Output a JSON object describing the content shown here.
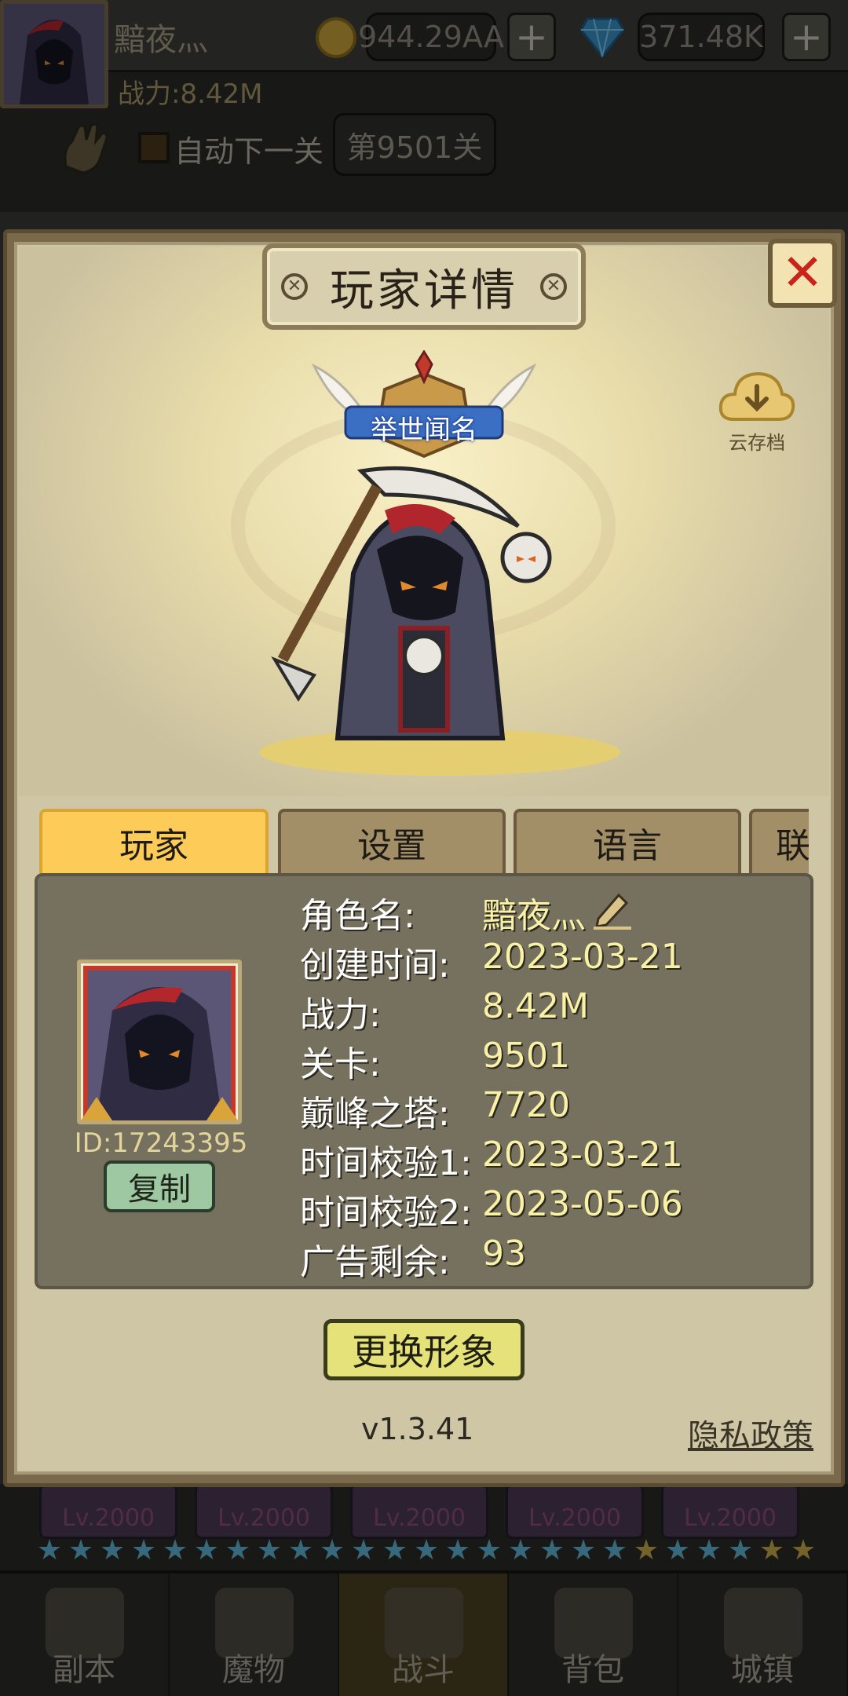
{
  "topbar": {
    "player_name": "黯夜灬",
    "power": "战力:8.42M",
    "gold": "944.29AA",
    "gems": "371.48K",
    "plus_symbol": "+",
    "auto_next": "自动下一关",
    "stage": "第9501关"
  },
  "bottom": {
    "card_levels": [
      "Lv.2000",
      "Lv.2000",
      "Lv.2000",
      "Lv.2000",
      "Lv.2000"
    ],
    "nav": [
      {
        "label": "副本",
        "icon": "map-icon"
      },
      {
        "label": "魔物",
        "icon": "monster-icon"
      },
      {
        "label": "战斗",
        "icon": "crossed-swords-icon"
      },
      {
        "label": "背包",
        "icon": "backpack-icon"
      },
      {
        "label": "城镇",
        "icon": "town-icon"
      }
    ]
  },
  "modal": {
    "title": "玩家详情",
    "close_symbol": "✕",
    "cloud_save": "云存档",
    "badge_title": "举世闻名",
    "tabs": [
      "玩家",
      "设置",
      "语言",
      "联"
    ],
    "player": {
      "id": "ID:17243395",
      "copy": "复制",
      "rows": [
        {
          "label": "角色名:",
          "value": "黯夜灬"
        },
        {
          "label": "创建时间:",
          "value": "2023-03-21"
        },
        {
          "label": "战力:",
          "value": "8.42M"
        },
        {
          "label": "关卡:",
          "value": "9501"
        },
        {
          "label": "巅峰之塔:",
          "value": "7720"
        },
        {
          "label": "时间校验1:",
          "value": "2023-03-21"
        },
        {
          "label": "时间校验2:",
          "value": "2023-05-06"
        },
        {
          "label": "广告剩余:",
          "value": "93"
        }
      ]
    },
    "change_avatar": "更换形象",
    "version": "v1.3.41",
    "privacy": "隐私政策"
  },
  "colors": {
    "tab_active": "#fdcc58",
    "value_text": "#f9f1a6",
    "close_x": "#c8241c",
    "id_text": "#e2d49a"
  }
}
